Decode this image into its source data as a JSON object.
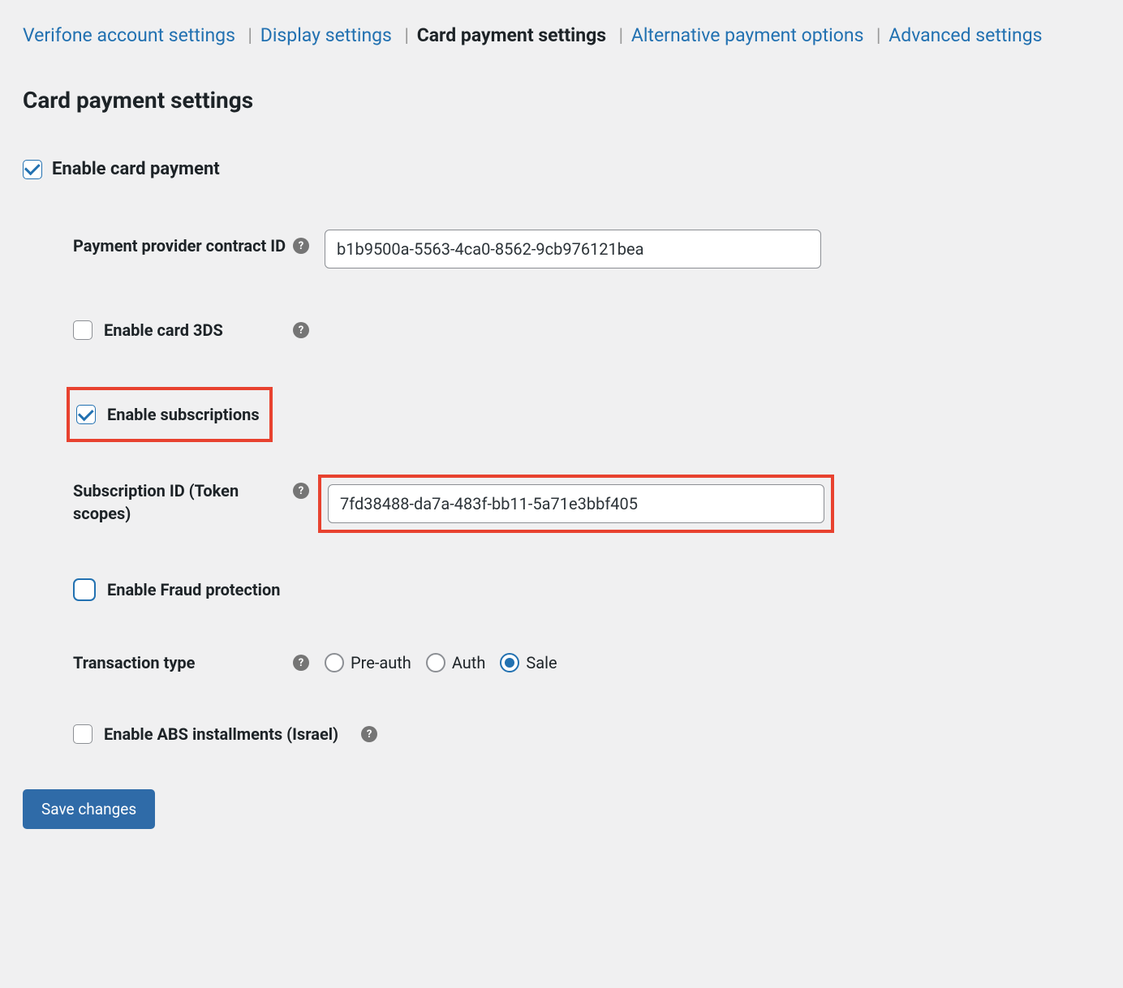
{
  "tabs": {
    "verifone": "Verifone account settings",
    "display": "Display settings",
    "card": "Card payment settings",
    "alternative": "Alternative payment options",
    "advanced": "Advanced settings"
  },
  "section_title": "Card payment settings",
  "enable_card_payment_label": "Enable card payment",
  "provider": {
    "label": "Payment provider contract ID",
    "value": "b1b9500a-5563-4ca0-8562-9cb976121bea"
  },
  "enable_3ds_label": "Enable card 3DS",
  "enable_subscriptions_label": "Enable subscriptions",
  "subscription": {
    "label": "Subscription ID (Token scopes)",
    "value": "7fd38488-da7a-483f-bb11-5a71e3bbf405"
  },
  "enable_fraud_label": "Enable Fraud protection",
  "transaction_type": {
    "label": "Transaction type",
    "options": {
      "preauth": "Pre-auth",
      "auth": "Auth",
      "sale": "Sale"
    },
    "selected": "sale"
  },
  "enable_abs_label": "Enable ABS installments (Israel)",
  "save_button": "Save changes"
}
